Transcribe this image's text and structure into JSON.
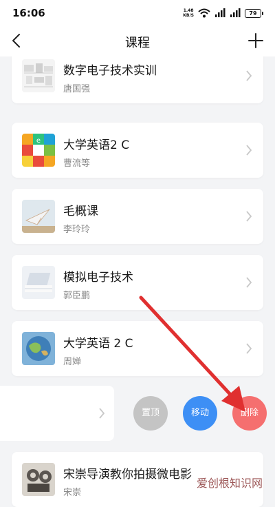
{
  "status_bar": {
    "time": "16:06",
    "net_speed_value": "1.48",
    "net_speed_unit": "KB/S",
    "battery": "79"
  },
  "nav": {
    "title": "课程"
  },
  "courses": [
    {
      "name": "数字电子技术实训",
      "teacher": "唐国强"
    },
    {
      "name": "大学英语2 C",
      "teacher": "曹流等"
    },
    {
      "name": "毛概课",
      "teacher": "李玲玲"
    },
    {
      "name": "模拟电子技术",
      "teacher": "郭臣鹏"
    },
    {
      "name": "大学英语 2 C",
      "teacher": "周婵"
    },
    {
      "name": "宋崇导演教你拍摄微电影",
      "teacher": "宋崇"
    }
  ],
  "swipe_actions": {
    "pin": "置顶",
    "move": "移动",
    "delete": "删除"
  },
  "watermark": {
    "text": "爱创根知识网",
    "accent": "#e03030"
  }
}
